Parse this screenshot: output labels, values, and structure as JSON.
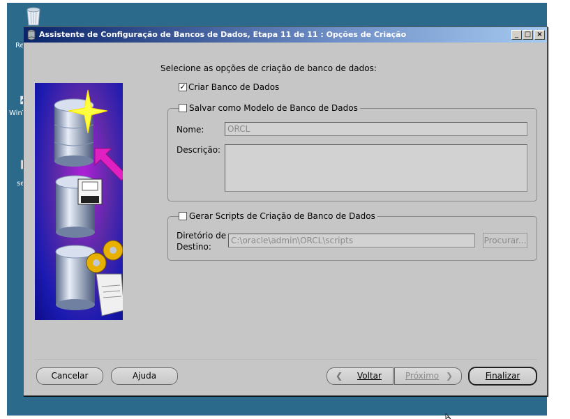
{
  "window": {
    "title": "Assistente de Configuração de Bancos de Dados, Etapa 11 de 11 : Opções de Criação",
    "minimize_label": "_",
    "maximize_label": "□",
    "close_label": "×"
  },
  "desktop": {
    "icons": [
      {
        "label": "Re",
        "icon": "recycle-bin-icon"
      },
      {
        "label": "WinT",
        "icon": "winscp-icon"
      },
      {
        "label": "se",
        "icon": "file-icon"
      }
    ]
  },
  "main": {
    "prompt": "Selecione as opções de criação de banco de dados:",
    "create_db": {
      "label": "Criar Banco de Dados",
      "checked": true,
      "mark": "✓"
    },
    "save_template": {
      "label": "Salvar como Modelo de Banco de Dados",
      "checked": false,
      "name_label": "Nome:",
      "name_value": "ORCL",
      "description_label": "Descrição:",
      "description_value": ""
    },
    "gen_scripts": {
      "label": "Gerar Scripts de Criação de Banco de Dados",
      "checked": false,
      "dir_label_line1": "Diretório de",
      "dir_label_line2": "Destino:",
      "dir_value": "C:\\oracle\\admin\\ORCL\\scripts",
      "browse_label": "Procurar..."
    }
  },
  "footer": {
    "cancel_label": "Cancelar",
    "help_label": "Ajuda",
    "back_arrow": "❮",
    "back_label": "Voltar",
    "next_label": "Próximo",
    "next_arrow": "❯",
    "finish_label": "Finalizar"
  },
  "colors": {
    "desktop_bg": "#2b6a8a",
    "window_bg": "#c6c6c6",
    "titlebar_start": "#0a246a",
    "titlebar_end": "#a6caf0",
    "illustration_arrow": "#e020c0",
    "illustration_star": "#ffff40"
  }
}
